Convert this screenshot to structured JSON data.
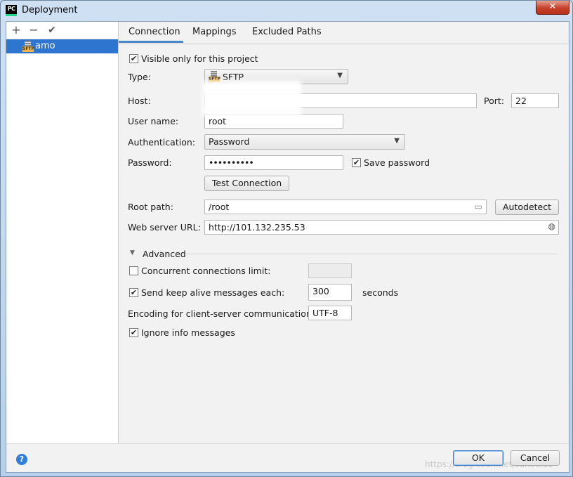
{
  "window": {
    "title": "Deployment",
    "app_icon": "PC",
    "close_glyph": "✕"
  },
  "left_toolbar": {
    "add": "+",
    "remove": "−",
    "apply": "✔"
  },
  "servers": [
    {
      "name": "amo",
      "icon": "sftp-icon",
      "selected": true
    }
  ],
  "sftp_badge": "SFTP",
  "tabs": [
    {
      "label": "Connection",
      "active": true
    },
    {
      "label": "Mappings"
    },
    {
      "label": "Excluded Paths"
    }
  ],
  "connection": {
    "visible_only_label": "Visible only for this project",
    "visible_only_checked": true,
    "type_label": "Type:",
    "type_value": "SFTP",
    "host_label": "Host:",
    "host_value": "",
    "port_label": "Port:",
    "port_value": "22",
    "user_label": "User name:",
    "user_value": "root",
    "auth_label": "Authentication:",
    "auth_value": "Password",
    "password_label": "Password:",
    "password_value": "••••••••••",
    "save_password_label": "Save password",
    "save_password_checked": true,
    "test_connection_label": "Test Connection",
    "root_path_label": "Root path:",
    "root_path_value": "/root",
    "autodetect_label": "Autodetect",
    "web_url_label": "Web server URL:",
    "web_url_value": "http://101.132.235.53"
  },
  "advanced": {
    "title": "Advanced",
    "concurrent_label": "Concurrent connections limit:",
    "concurrent_checked": false,
    "concurrent_value": "",
    "keepalive_label": "Send keep alive messages each:",
    "keepalive_checked": true,
    "keepalive_value": "300",
    "keepalive_unit": "seconds",
    "encoding_label": "Encoding for client-server communication:",
    "encoding_value": "UTF-8",
    "ignore_info_label": "Ignore info messages",
    "ignore_info_checked": true
  },
  "footer": {
    "help": "?",
    "ok_label": "OK",
    "cancel_label": "Cancel",
    "watermark": "https://blog.csdn.net/sanbai12"
  },
  "colors": {
    "selection": "#2e75d0",
    "tab_underline": "#4a88c7",
    "close_button": "#c7402a"
  }
}
